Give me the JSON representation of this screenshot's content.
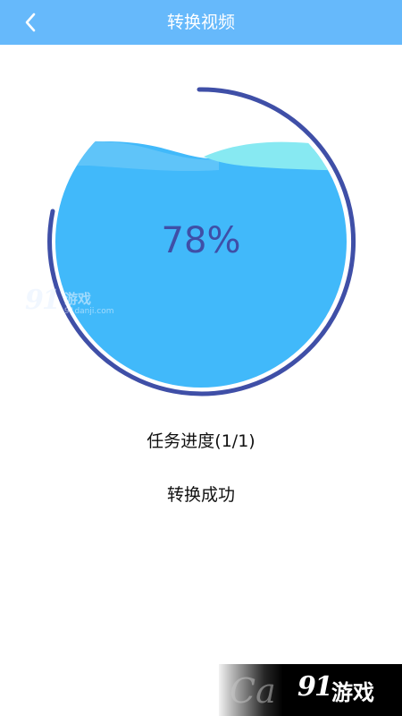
{
  "header": {
    "title": "转换视频",
    "back_icon": "chevron-left-icon"
  },
  "gauge": {
    "percent_text": "78%",
    "progress": 0.78,
    "ring_color": "#3f4fa7",
    "water_color": "#41b9fa",
    "wave_back_color": "#5fc4f9",
    "wave_front_color": "#87e9f2"
  },
  "watermark": {
    "logo": "91",
    "cn": "游戏",
    "url": "91danji.com"
  },
  "task": {
    "progress_label": "任务进度(1/1)",
    "status": "转换成功"
  },
  "corner_logo": {
    "ghost": "Ca",
    "logo": "91",
    "cn": "游戏"
  }
}
